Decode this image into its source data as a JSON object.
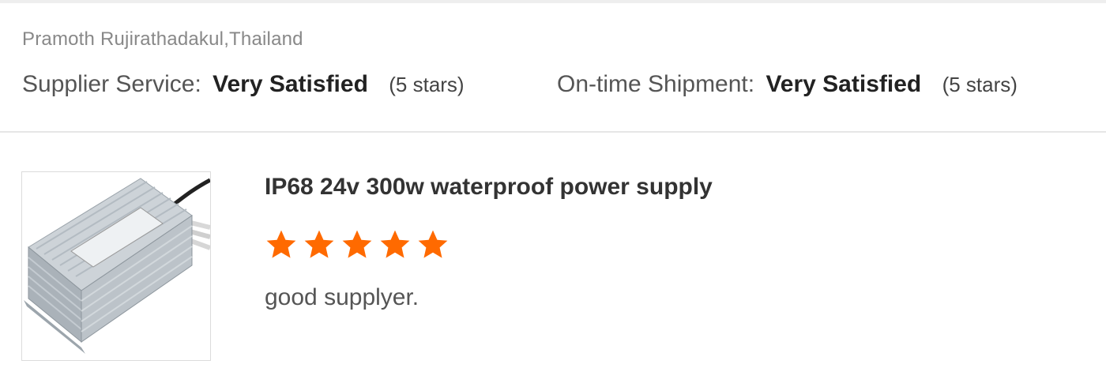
{
  "review": {
    "reviewer": "Pramoth Rujirathadakul,Thailand",
    "supplier_service": {
      "label": "Supplier Service:",
      "value": "Very Satisfied",
      "stars_text": "(5 stars)"
    },
    "shipment": {
      "label": "On-time Shipment:",
      "value": "Very Satisfied",
      "stars_text": "(5 stars)"
    },
    "product": {
      "title": "IP68 24v 300w waterproof power supply",
      "image_icon": "power-supply-image",
      "rating": 5,
      "rating_max": 5,
      "comment": "good supplyer."
    }
  },
  "colors": {
    "star": "#ff6a00",
    "divider": "#e6e6e6",
    "text_muted": "#888888"
  }
}
